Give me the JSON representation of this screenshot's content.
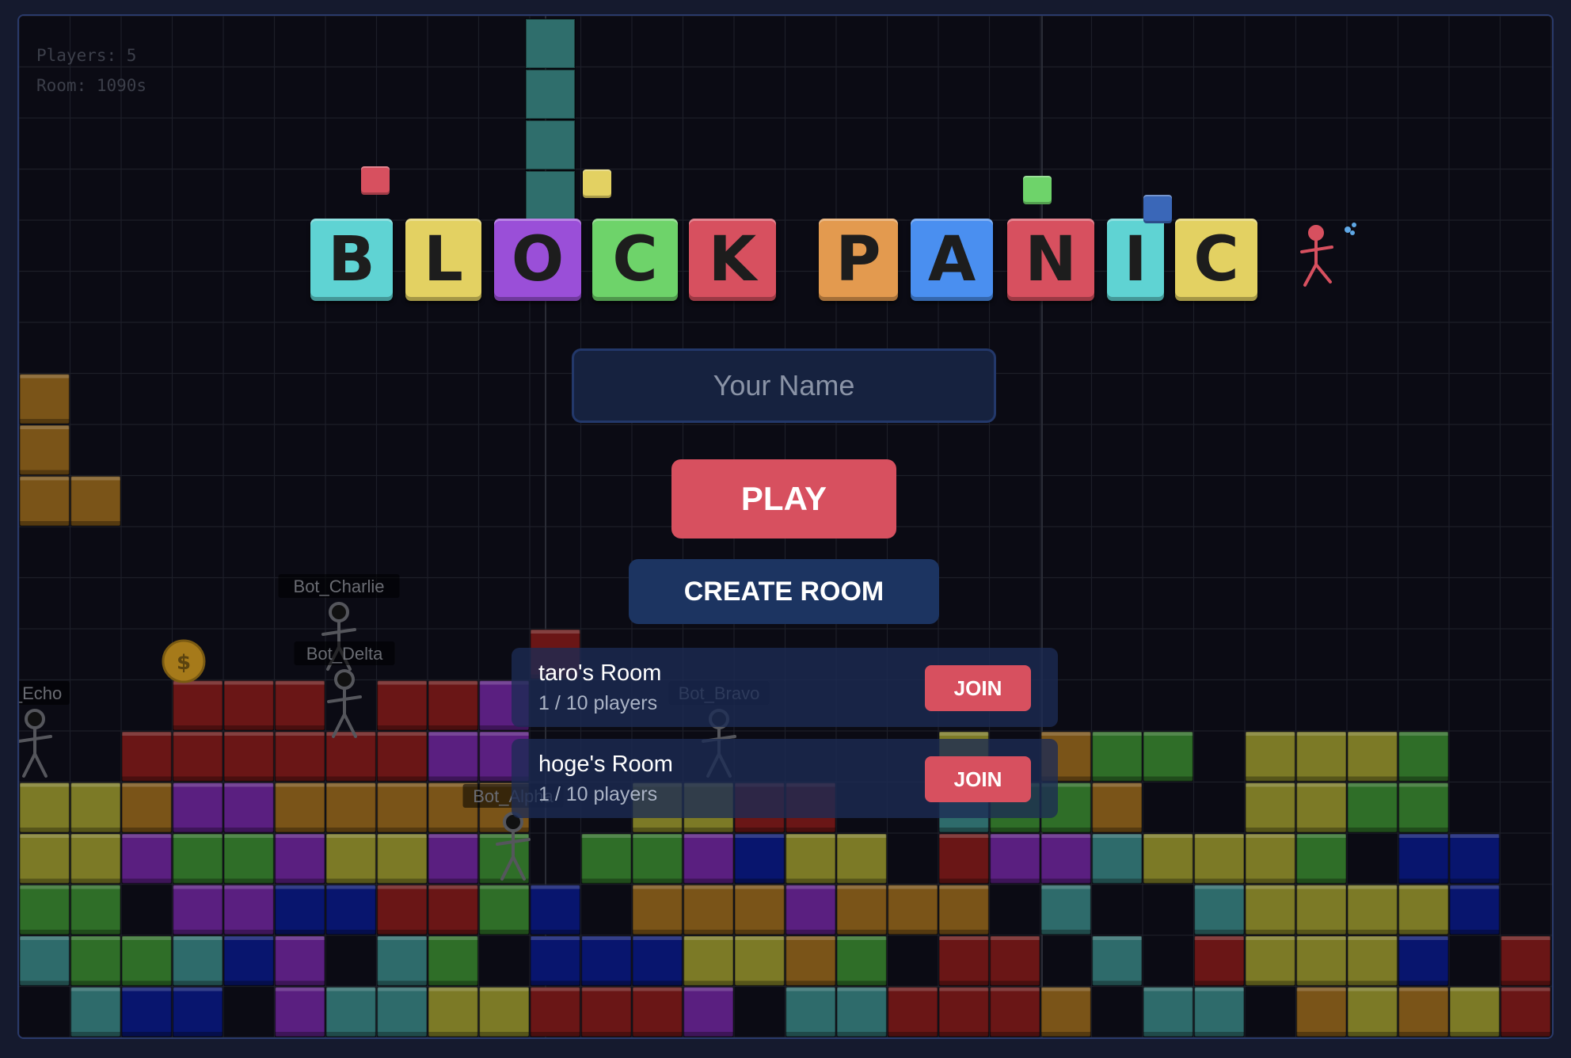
{
  "hud": {
    "players_label": "Players: 5",
    "room_label": "Room: 1090s"
  },
  "logo": {
    "letters": [
      {
        "char": "B",
        "color": "#5fd3d3"
      },
      {
        "char": "L",
        "color": "#e3d162"
      },
      {
        "char": "O",
        "color": "#9a4fd8"
      },
      {
        "char": "C",
        "color": "#6ed36a"
      },
      {
        "char": "K",
        "color": "#d7505f"
      },
      {
        "char": "P",
        "color": "#e39a4f"
      },
      {
        "char": "A",
        "color": "#4a8ff0"
      },
      {
        "char": "N",
        "color": "#d7505f"
      },
      {
        "char": "I",
        "color": "#5fd3d3"
      },
      {
        "char": "C",
        "color": "#e3d162"
      }
    ],
    "mascot_icon": "stick-figure-icon"
  },
  "name_input": {
    "placeholder": "Your Name",
    "value": ""
  },
  "play_button": "PLAY",
  "create_room_button": "CREATE ROOM",
  "rooms": [
    {
      "name": "taro's Room",
      "players": "1 / 10 players",
      "join_label": "JOIN"
    },
    {
      "name": "hoge's Room",
      "players": "1 / 10 players",
      "join_label": "JOIN"
    }
  ],
  "bots": [
    "Bot_Charlie",
    "Bot_Delta",
    "t_Echo",
    "Bot_Bravo",
    "Bot_Alpha"
  ],
  "coin_icon": "$",
  "colors": {
    "accent": "#d7505f",
    "panel": "#1c3461",
    "background": "#0b0b14"
  }
}
